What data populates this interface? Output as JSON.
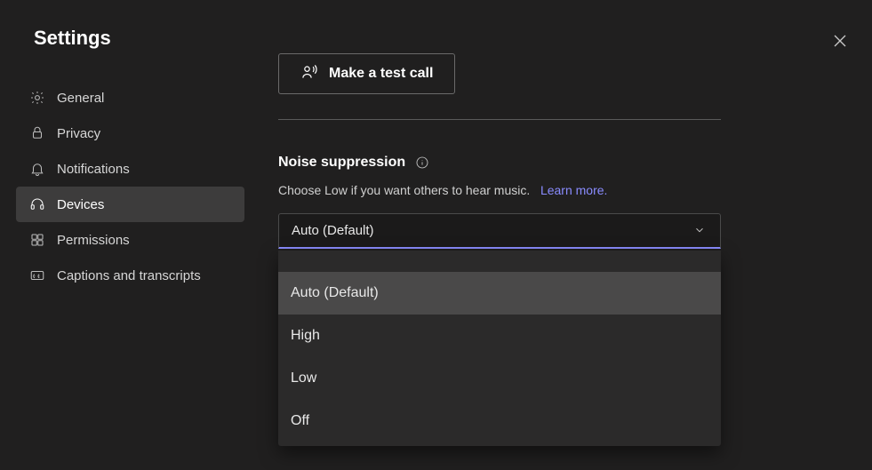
{
  "header": {
    "title": "Settings"
  },
  "sidebar": {
    "items": [
      {
        "label": "General"
      },
      {
        "label": "Privacy"
      },
      {
        "label": "Notifications"
      },
      {
        "label": "Devices"
      },
      {
        "label": "Permissions"
      },
      {
        "label": "Captions and transcripts"
      }
    ],
    "activeIndex": 3
  },
  "main": {
    "testCallLabel": "Make a test call",
    "noiseSuppression": {
      "title": "Noise suppression",
      "description": "Choose Low if you want others to hear music.",
      "learnMore": "Learn more.",
      "selected": "Auto (Default)",
      "options": [
        "Auto (Default)",
        "High",
        "Low",
        "Off"
      ]
    }
  }
}
